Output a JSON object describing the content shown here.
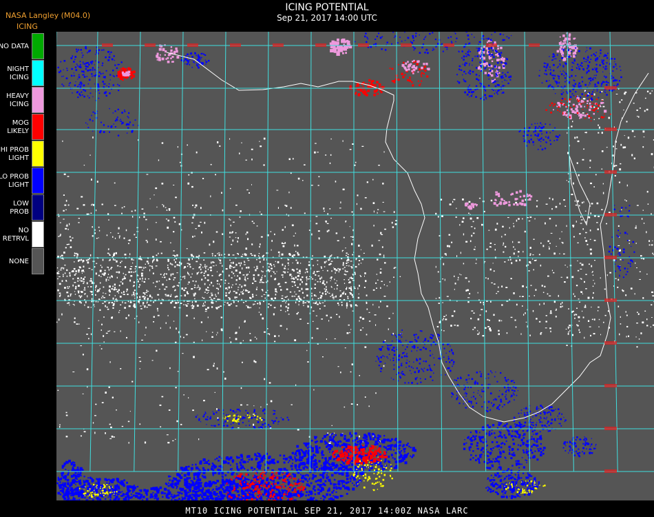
{
  "header": {
    "credit": "NASA Langley (M04.0)",
    "product": "ICING",
    "title": "ICING POTENTIAL",
    "subtitle": "Sep 21, 2017 14:00 UTC"
  },
  "legend": [
    {
      "label": "NO DATA",
      "color": "#00aa00"
    },
    {
      "label": "NIGHT\nICING",
      "color": "#00ffff"
    },
    {
      "label": "HEAVY\nICING",
      "color": "#ee99dd"
    },
    {
      "label": "MOG\nLIKELY",
      "color": "#ff0000"
    },
    {
      "label": "HI PROB\nLIGHT",
      "color": "#ffff00"
    },
    {
      "label": "LO PROB\nLIGHT",
      "color": "#0000ff"
    },
    {
      "label": "LOW\nPROB",
      "color": "#000080"
    },
    {
      "label": "NO\nRETRVL",
      "color": "#ffffff"
    },
    {
      "label": "NONE",
      "color": "#555555"
    }
  ],
  "map": {
    "background": "#555555",
    "grid_color": "#40e0e0",
    "label_color": "#dd2222",
    "coast_color": "#ffffff"
  },
  "footer": {
    "text": "MT10  ICING POTENTIAL   SEP 21, 2017 14:00Z   NASA LARC"
  }
}
